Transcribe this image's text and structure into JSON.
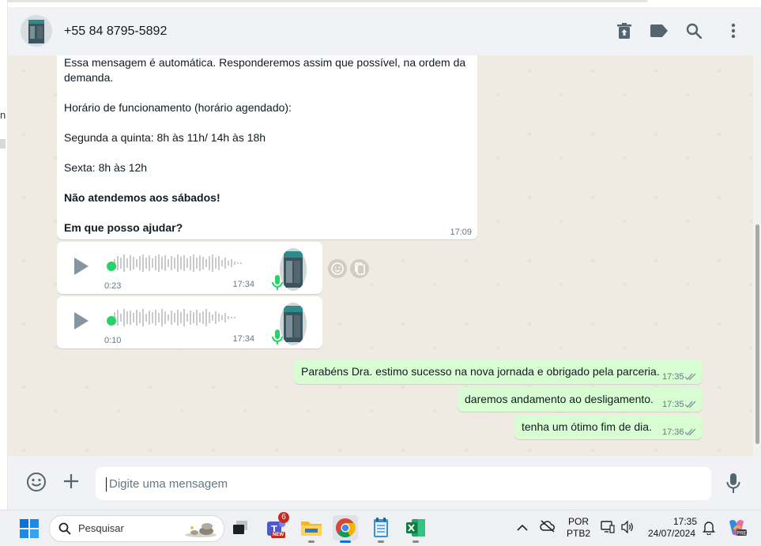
{
  "header": {
    "contact_name": "+55 84 8795-5892",
    "icons": [
      "trash-icon",
      "label-icon",
      "search-icon",
      "menu-icon"
    ]
  },
  "messages": {
    "auto_reply": {
      "line1": "Essa mensagem é automática. Responderemos assim que possível, na ordem da",
      "line2": "demanda.",
      "line3": "Horário de funcionamento (horário agendado):",
      "line4": "Segunda a quinta: 8h às 11h/ 14h às 18h",
      "line5": "Sexta: 8h às 12h",
      "line6": "Não atendemos aos sábados!",
      "line7": "Em que posso ajudar?",
      "time": "17:09"
    },
    "voice1": {
      "duration": "0:23",
      "time": "17:34"
    },
    "voice2": {
      "duration": "0:10",
      "time": "17:34"
    },
    "out1": {
      "text": "Parabéns Dra. estimo sucesso na nova jornada e obrigado pela parceria.",
      "time": "17:35"
    },
    "out2": {
      "text": "daremos andamento ao desligamento.",
      "time": "17:35"
    },
    "out3": {
      "text": "tenha um ótimo fim de dia.",
      "time": "17:36"
    }
  },
  "composer": {
    "placeholder": "Digite uma mensagem"
  },
  "taskbar": {
    "search_label": "Pesquisar",
    "teams_badge": "6",
    "teams_new": "NEW",
    "lang1": "POR",
    "lang2": "PTB2",
    "clock_time": "17:35",
    "clock_date": "24/07/2024",
    "left_fragment": "n"
  },
  "colors": {
    "accent_green": "#25d366",
    "outgoing_bubble": "#d9fdd3",
    "chat_bg": "#efeae2"
  }
}
